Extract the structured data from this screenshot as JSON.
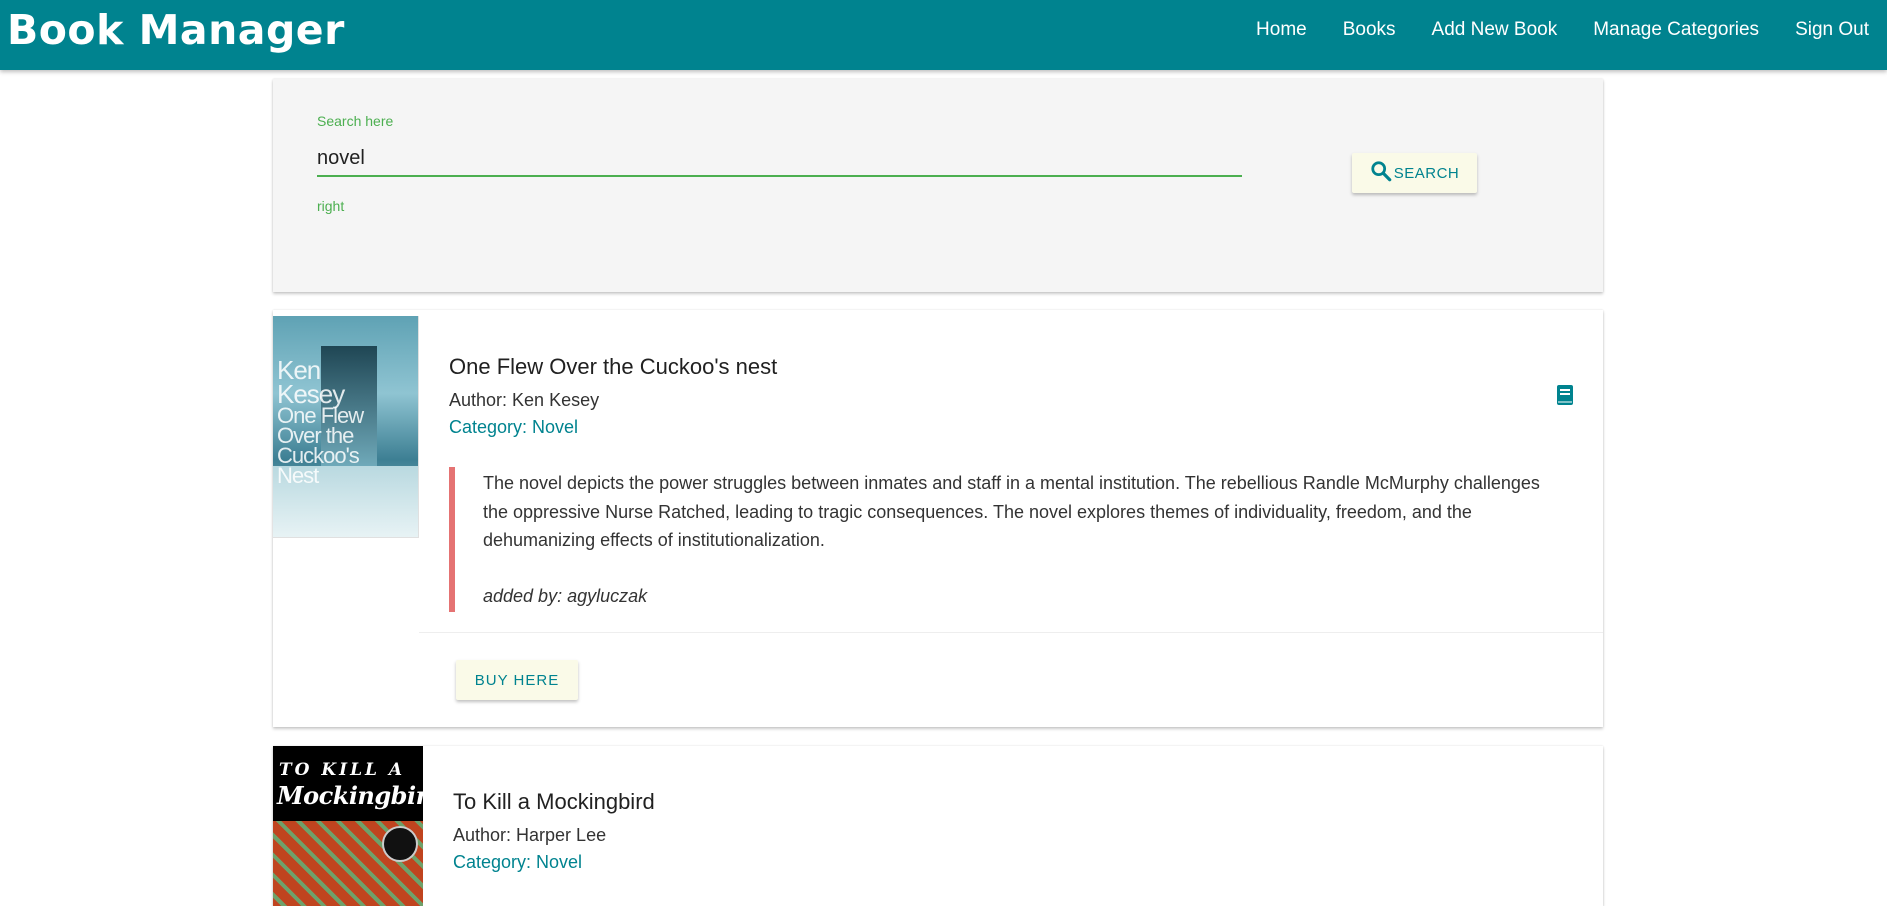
{
  "app": {
    "title": "Book Manager"
  },
  "nav": [
    {
      "label": "Home"
    },
    {
      "label": "Books"
    },
    {
      "label": "Add New Book"
    },
    {
      "label": "Manage Categories"
    },
    {
      "label": "Sign Out"
    }
  ],
  "search": {
    "label": "Search here",
    "value": "novel",
    "helper": "right",
    "button_label": "SEARCH"
  },
  "books": [
    {
      "title": "One Flew Over the Cuckoo's nest",
      "author": "Author: Ken Kesey",
      "category": "Category: Novel",
      "description": "The novel depicts the power struggles between inmates and staff in a mental institution. The rebellious Randle McMurphy challenges the oppressive Nurse Ratched, leading to tragic consequences. The novel explores themes of individuality, freedom, and the dehumanizing effects of institutionalization.",
      "added_by": "added by: agyluczak",
      "buy_label": "BUY HERE",
      "cover_text": [
        "Ken",
        "Kesey",
        "One Flew",
        "Over the",
        "Cuckoo's",
        "Nest"
      ]
    },
    {
      "title": "To Kill a Mockingbird",
      "author": "Author: Harper Lee",
      "category": "Category: Novel",
      "cover_text": [
        "TO KILL A",
        "Mockingbird"
      ]
    }
  ],
  "colors": {
    "primary": "#00838f",
    "accent_green": "#4caf50",
    "quote_border": "#e57373",
    "button_bg": "#fafae8"
  },
  "icons": {
    "search": "search-icon",
    "book": "book-icon"
  }
}
